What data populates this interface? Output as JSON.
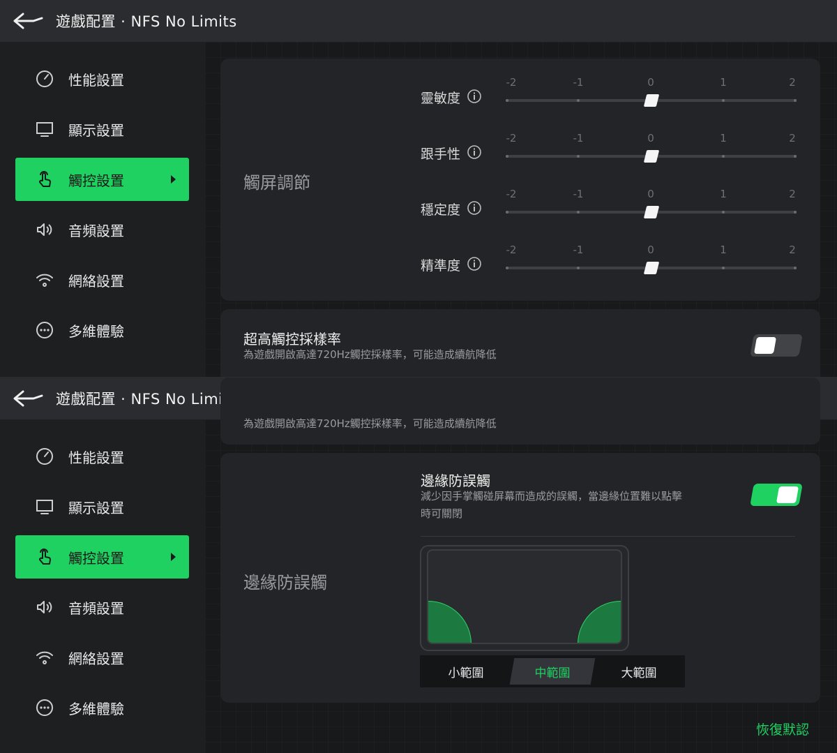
{
  "header": {
    "title": "遊戲配置 · NFS No Limits",
    "back_icon": "back-arrow-icon"
  },
  "sidebar": {
    "items": [
      {
        "label": "性能設置",
        "icon": "gauge-icon",
        "active": false
      },
      {
        "label": "顯示設置",
        "icon": "monitor-icon",
        "active": false
      },
      {
        "label": "觸控設置",
        "icon": "touch-hand-icon",
        "active": true
      },
      {
        "label": "音頻設置",
        "icon": "speaker-icon",
        "active": false
      },
      {
        "label": "網絡設置",
        "icon": "wifi-icon",
        "active": false
      },
      {
        "label": "多維體驗",
        "icon": "more-dots-icon",
        "active": false
      }
    ]
  },
  "touch_tuning": {
    "section_title": "觸屏調節",
    "ticks": [
      "-2",
      "-1",
      "0",
      "1",
      "2"
    ],
    "sliders": [
      {
        "label": "靈敏度",
        "value": 0
      },
      {
        "label": "跟手性",
        "value": 0
      },
      {
        "label": "穩定度",
        "value": 0
      },
      {
        "label": "精準度",
        "value": 0
      }
    ]
  },
  "high_sampling": {
    "title": "超高觸控採樣率",
    "description": "為遊戲開啟高達720Hz觸控採樣率，可能造成續航降低",
    "enabled": false
  },
  "edge_protection": {
    "section_title": "邊緣防誤觸",
    "title": "邊緣防誤觸",
    "description_line1": "減少因手掌觸碰屏幕而造成的誤觸，當邊緣位置難以點擊",
    "description_line2": "時可關閉",
    "enabled": true,
    "ranges": [
      "小範圍",
      "中範圍",
      "大範圍"
    ],
    "selected_range": "中範圍"
  },
  "footer": {
    "restore_default": "恢復默認"
  },
  "colors": {
    "accent": "#1fd161",
    "background": "#1e1f21",
    "card": "#232427"
  }
}
